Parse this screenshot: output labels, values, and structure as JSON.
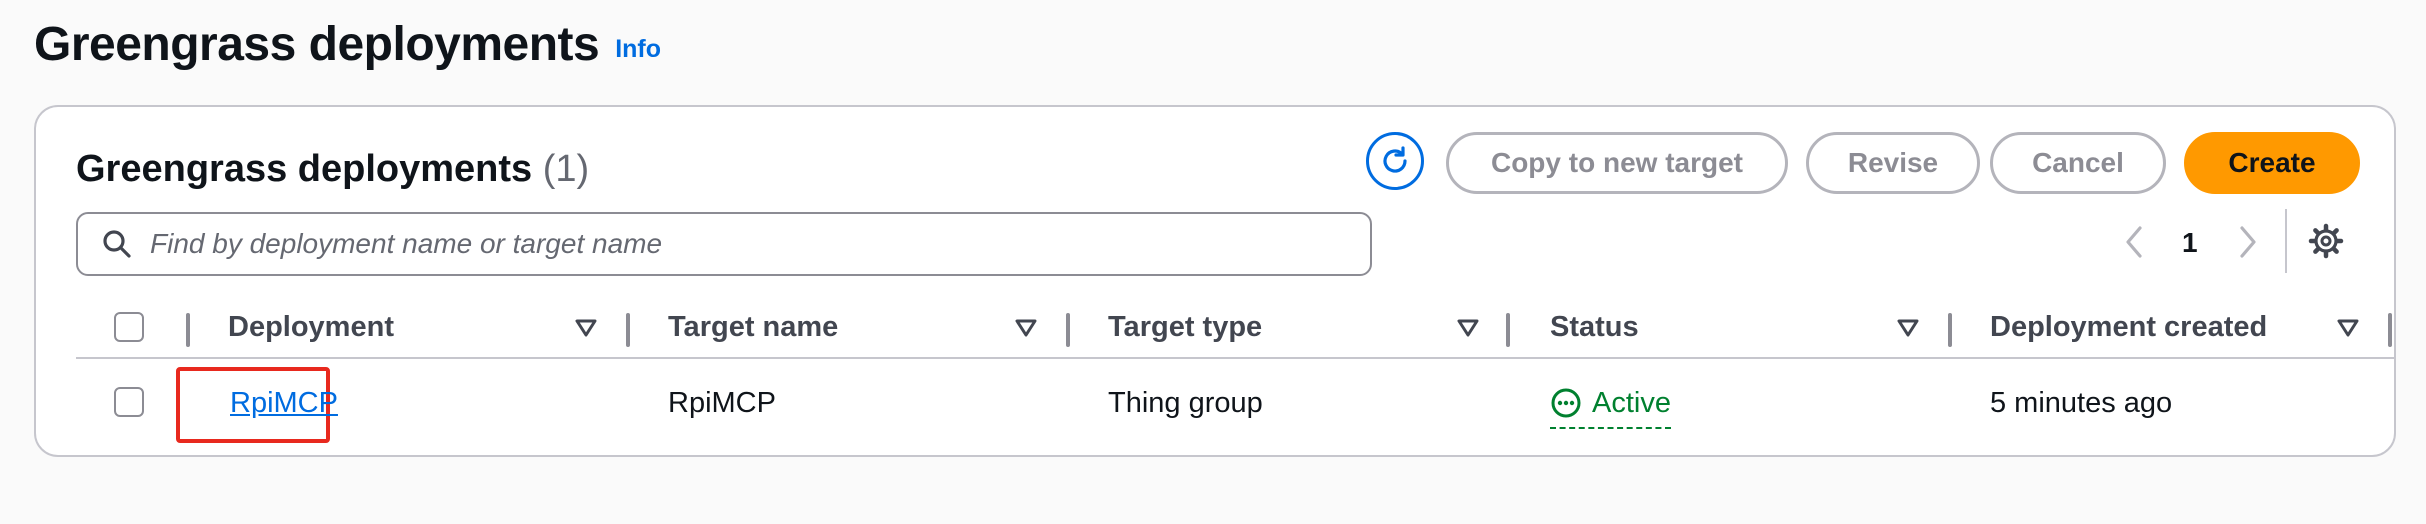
{
  "page": {
    "title": "Greengrass deployments",
    "info_label": "Info"
  },
  "card": {
    "title": "Greengrass deployments",
    "count": "(1)",
    "actions": {
      "copy": "Copy to new target",
      "revise": "Revise",
      "cancel": "Cancel",
      "create": "Create"
    },
    "search_placeholder": "Find by deployment name or target name",
    "pagination": {
      "current_page": "1"
    }
  },
  "table": {
    "columns": [
      "Deployment",
      "Target name",
      "Target type",
      "Status",
      "Deployment created"
    ],
    "rows": [
      {
        "deployment": "RpiMCP",
        "target_name": "RpiMCP",
        "target_type": "Thing group",
        "status": "Active",
        "created": "5 minutes ago"
      }
    ]
  },
  "colors": {
    "link": "#006ce0",
    "primary_button": "#ff9900",
    "status_active": "#00802f",
    "highlight": "#e8291e"
  },
  "icons": [
    "refresh-icon",
    "search-icon",
    "chevron-left-icon",
    "chevron-right-icon",
    "gear-icon",
    "sort-icon",
    "status-in-progress-icon"
  ]
}
